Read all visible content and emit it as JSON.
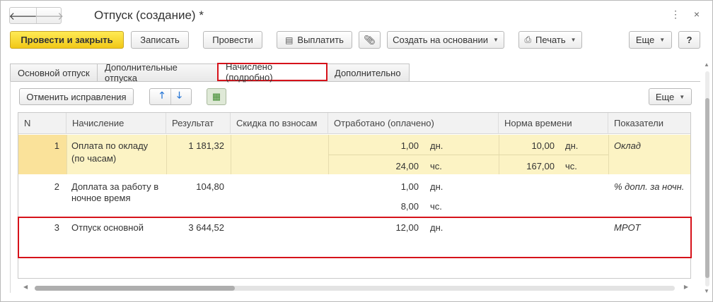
{
  "window": {
    "title": "Отпуск (создание) *",
    "back_glyph": "🡐",
    "fwd_glyph": "🡒",
    "menu_glyph": "⋮",
    "close_glyph": "×"
  },
  "toolbar": {
    "post_close": "Провести и закрыть",
    "save": "Записать",
    "post": "Провести",
    "pay": "Выплатить",
    "create_based": "Создать на основании",
    "print": "Печать",
    "more": "Еще",
    "help": "?"
  },
  "tabs": [
    {
      "label": "Основной отпуск"
    },
    {
      "label": "Дополнительные отпуска"
    },
    {
      "label": "Начислено (подробно)"
    },
    {
      "label": "Дополнительно"
    }
  ],
  "table_toolbar": {
    "cancel_corrections": "Отменить исправления",
    "more": "Еще"
  },
  "columns": [
    "N",
    "Начисление",
    "Результат",
    "Скидка по взносам",
    "Отработано (оплачено)",
    "Норма времени",
    "Показатели"
  ],
  "rows": [
    {
      "n": "1",
      "accrual_line1": "Оплата по окладу",
      "accrual_line2": "(по часам)",
      "result": "1 181,32",
      "worked1": "1,00",
      "worked1_unit": "дн.",
      "worked2": "24,00",
      "worked2_unit": "чс.",
      "norm1": "10,00",
      "norm1_unit": "дн.",
      "norm2": "167,00",
      "norm2_unit": "чс.",
      "indicator": "Оклад"
    },
    {
      "n": "2",
      "accrual_line1": "Доплата за работу в",
      "accrual_line2": "ночное время",
      "result": "104,80",
      "worked1": "1,00",
      "worked1_unit": "дн.",
      "worked2": "8,00",
      "worked2_unit": "чс.",
      "indicator": "% допл. за ночн."
    },
    {
      "n": "3",
      "accrual_line1": "Отпуск основной",
      "result": "3 644,52",
      "worked1": "12,00",
      "worked1_unit": "дн.",
      "indicator": "МРОТ"
    }
  ],
  "colors": {
    "primary_button": "#f1c817",
    "highlight_border": "#d6121a",
    "selected_row": "#fcf3c4"
  }
}
